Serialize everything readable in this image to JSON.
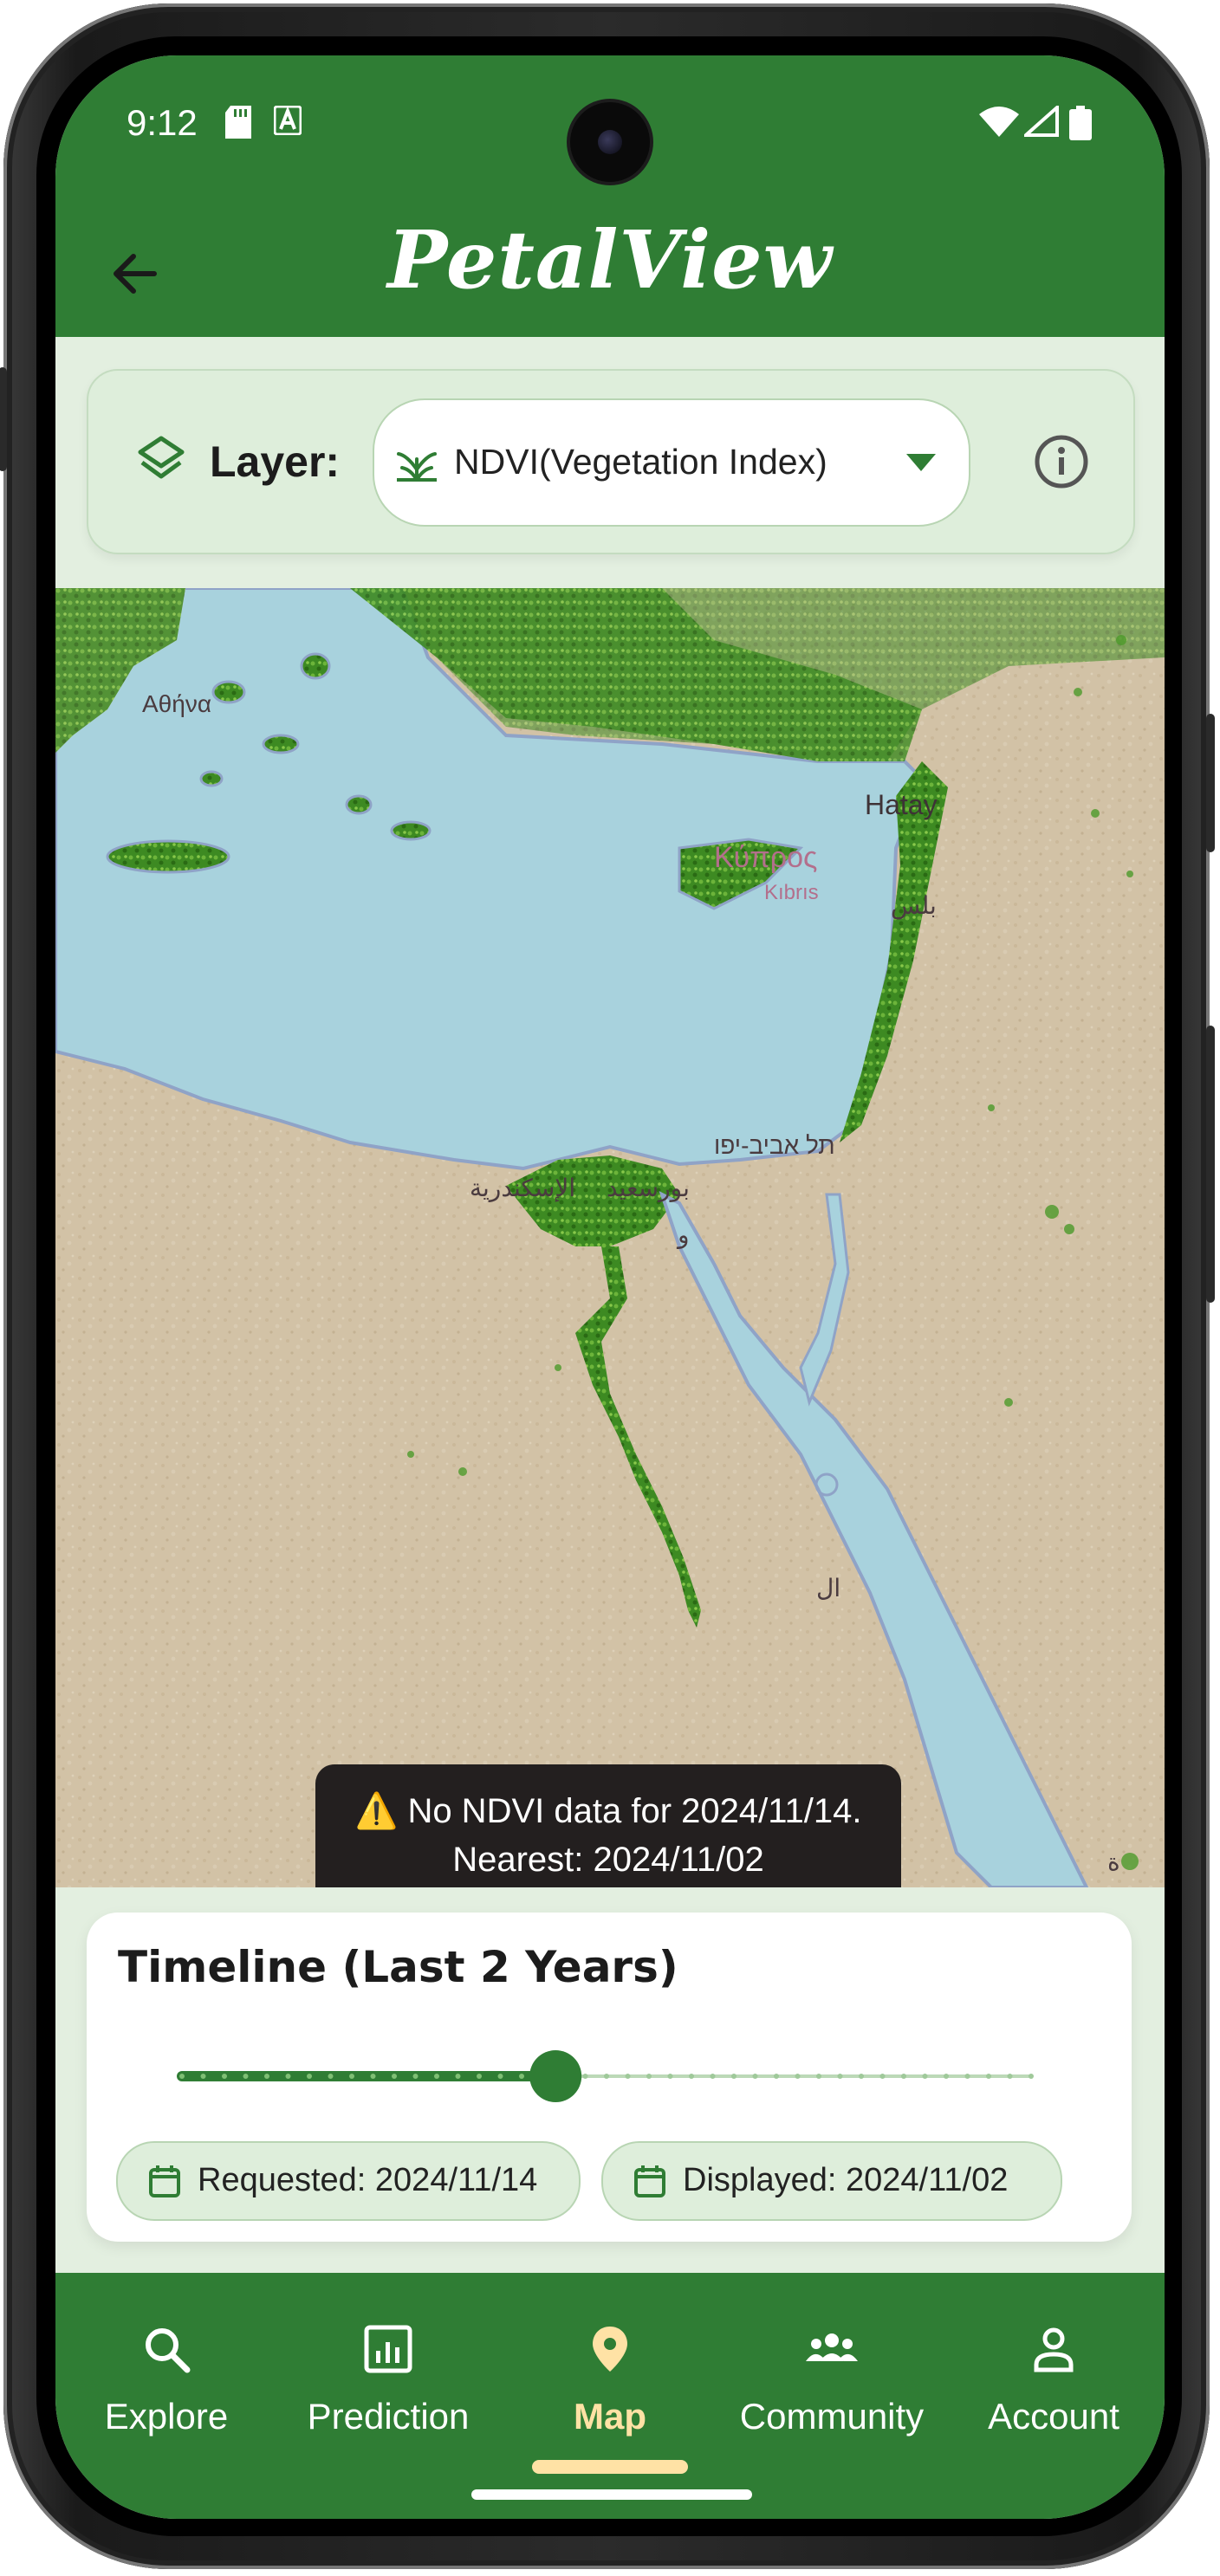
{
  "status_bar": {
    "time": "9:12"
  },
  "header": {
    "title": "PetalView"
  },
  "layer_bar": {
    "label": "Layer:",
    "selected": "NDVI(Vegetation Index)"
  },
  "map": {
    "labels": {
      "athens": "Αθήνα",
      "hatay": "Hatay",
      "cyprus": "Κύπρος",
      "cyprus_sub": "Kıbrıs",
      "beirut": "بلس",
      "tel_aviv": "תל אביב-יפו",
      "port_said": "بورسعيد",
      "alexandria": "الإسكندرية",
      "sinai": "و",
      "red_sea": "ال",
      "east_edge": "ة"
    },
    "toast": {
      "line1": "No NDVI data for 2024/11/14.",
      "line2": "Nearest: 2024/11/02"
    }
  },
  "timeline": {
    "title": "Timeline (Last 2 Years)",
    "slider_position": 0.44,
    "requested": "Requested: 2024/11/14",
    "displayed": "Displayed: 2024/11/02"
  },
  "nav": {
    "items": [
      {
        "label": "Explore",
        "icon": "search-icon"
      },
      {
        "label": "Prediction",
        "icon": "chart-icon"
      },
      {
        "label": "Map",
        "icon": "location-pin-icon"
      },
      {
        "label": "Community",
        "icon": "group-icon"
      },
      {
        "label": "Account",
        "icon": "person-icon"
      }
    ],
    "active": "Map"
  },
  "colors": {
    "primary": "#2f7d34",
    "surface": "#deeedb",
    "accent": "#ffe2a5",
    "sea": "#a8d2dd",
    "land": "#d2c2a6",
    "vegetation": "#4c9a2a"
  }
}
